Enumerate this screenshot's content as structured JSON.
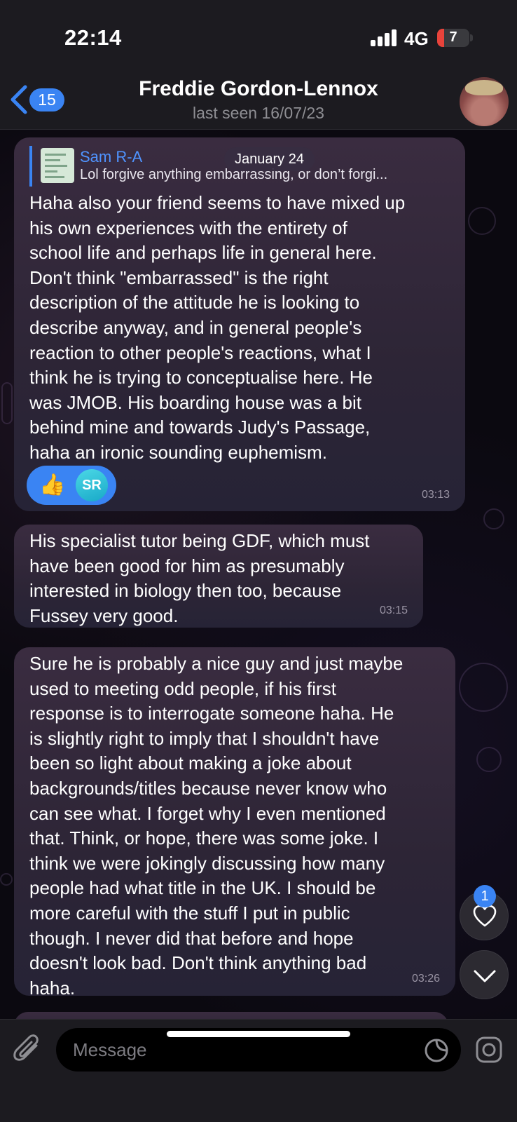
{
  "status_bar": {
    "time": "22:14",
    "network": "4G",
    "battery": "7"
  },
  "header": {
    "back_count": "15",
    "name": "Freddie Gordon-Lennox",
    "status": "last seen 16/07/23"
  },
  "chat": {
    "date_label": "January 24",
    "messages": [
      {
        "reply_to": {
          "name": "Sam R-A",
          "text": "Lol forgive anything embarrassing, or don’t forgi..."
        },
        "text": "Haha also your friend seems to have mixed up\nhis own experiences with the entirety of\nschool life and perhaps life in general here.\nDon't think \"embarrassed\" is the right\ndescription of the attitude he is looking to\ndescribe anyway, and in general people's\nreaction to other people's reactions, what I\nthink he is trying to conceptualise here. He\nwas JMOB. His boarding house was a bit\nbehind mine and towards Judy's Passage,\nhaha an ironic sounding euphemism.",
        "reactions": {
          "emoji": "👍",
          "avatar_initials": "SR"
        },
        "time": "03:13"
      },
      {
        "text": "His specialist tutor being GDF, which must\nhave been good for him as presumably\ninterested in biology then too, because\nFussey very good.",
        "time": "03:15"
      },
      {
        "text": "Sure he is probably a nice guy and just maybe\nused to meeting odd people, if his first\nresponse is to interrogate someone haha. He\nis slightly right to imply that I shouldn't have\nbeen so light about making a joke about\nbackgrounds/titles because never know who\ncan see what. I forget why I even mentioned\nthat. Think, or hope, there was some joke. I\nthink we were jokingly discussing how many\npeople had what title in the UK. I should be\nmore careful with the stuff I put in public\nthough. I never did that before and hope\ndoesn't look bad. Don't think anything bad\nhaha.",
        "time": "03:26"
      }
    ],
    "reaction_badge_count": "1"
  },
  "input": {
    "placeholder": "Message"
  },
  "icons": {
    "back": "chevron-left-icon",
    "signal": "signal-bars-icon",
    "heart": "heart-icon",
    "scroll_down": "chevron-down-icon",
    "attach": "paperclip-icon",
    "sticker": "sticker-icon",
    "camera": "instagram-camera-icon"
  },
  "colors": {
    "accent": "#3a84f3",
    "battery_low": "#e8433b",
    "header_bg": "#1c1b20"
  }
}
